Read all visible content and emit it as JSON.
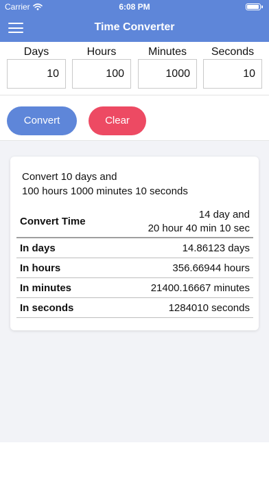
{
  "status_bar": {
    "carrier": "Carrier",
    "time": "6:08 PM",
    "wifi_icon": "wifi-icon",
    "battery_icon": "battery-icon"
  },
  "nav": {
    "title": "Time Converter",
    "menu_icon": "hamburger-menu-icon"
  },
  "inputs": [
    {
      "label": "Days",
      "value": "10"
    },
    {
      "label": "Hours",
      "value": "100"
    },
    {
      "label": "Minutes",
      "value": "1000"
    },
    {
      "label": "Seconds",
      "value": "10"
    }
  ],
  "buttons": {
    "convert": "Convert",
    "clear": "Clear"
  },
  "result": {
    "summary_line1": "Convert 10 days and",
    "summary_line2": "100 hours 1000 minutes 10 seconds",
    "rows": [
      {
        "label": "Convert Time",
        "value_line1": "14 day and",
        "value_line2": "20 hour 40 min 10 sec"
      },
      {
        "label": "In days",
        "value": "14.86123 days"
      },
      {
        "label": "In hours",
        "value": "356.66944 hours"
      },
      {
        "label": "In minutes",
        "value": "21400.16667 minutes"
      },
      {
        "label": "In seconds",
        "value": "1284010 seconds"
      }
    ]
  },
  "colors": {
    "primary": "#5e86d9",
    "danger": "#ed4a63",
    "background": "#f2f3f7"
  }
}
